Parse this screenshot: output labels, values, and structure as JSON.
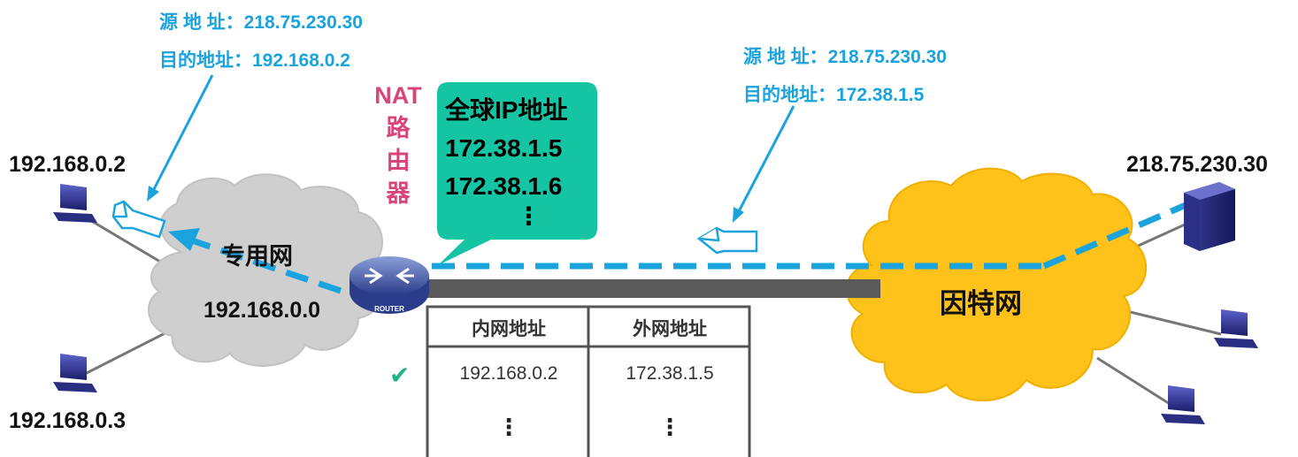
{
  "left_packet": {
    "src_label": "源 地 址：",
    "src_value": "218.75.230.30",
    "dst_label": "目的地址：",
    "dst_value": "192.168.0.2"
  },
  "right_packet": {
    "src_label": "源 地 址：",
    "src_value": "218.75.230.30",
    "dst_label": "目的地址：",
    "dst_value": "172.38.1.5"
  },
  "hosts": {
    "host_a": "192.168.0.2",
    "host_b": "192.168.0.3",
    "server": "218.75.230.30"
  },
  "private_network": {
    "name": "专用网",
    "address": "192.168.0.0"
  },
  "internet": {
    "name": "因特网"
  },
  "nat_router": {
    "label_chars": [
      "NAT",
      "路",
      "由",
      "器"
    ],
    "device_text": "ROUTER"
  },
  "global_ip_bubble": {
    "title": "全球IP地址",
    "addresses": [
      "172.38.1.5",
      "172.38.1.6",
      "⋮"
    ]
  },
  "nat_table": {
    "headers": [
      "内网地址",
      "外网地址"
    ],
    "rows": [
      {
        "inner": "192.168.0.2",
        "outer": "172.38.1.5",
        "selected": true
      },
      {
        "inner": "⋮",
        "outer": "⋮",
        "selected": false
      }
    ],
    "check_symbol": "✔"
  },
  "colors": {
    "blue": "#1aa3dd",
    "nat_pink": "#d9457a",
    "bubble_teal": "#14c4a2",
    "cloud_gray": "#cfcfcf",
    "cloud_gold": "#ffc21a",
    "link_gray": "#5a5a5a",
    "check_green": "#22b38a"
  }
}
